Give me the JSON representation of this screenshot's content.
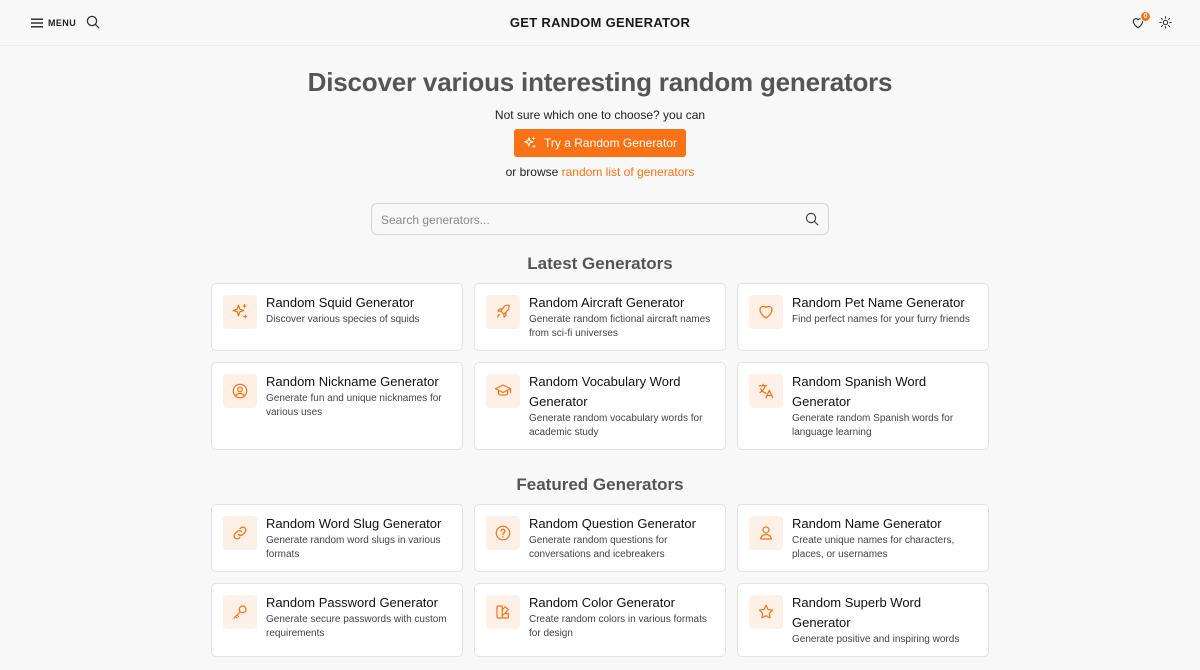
{
  "header": {
    "menu_label": "MENU",
    "brand": "GET RANDOM GENERATOR",
    "favorites_count": "0"
  },
  "hero": {
    "title": "Discover various interesting random generators",
    "subtitle": "Not sure which one to choose? you can",
    "try_button": "Try a Random Generator",
    "browse_prefix": "or browse",
    "browse_link": "random list of generators"
  },
  "search": {
    "placeholder": "Search generators..."
  },
  "latest": {
    "title": "Latest Generators",
    "items": [
      {
        "title": "Random Squid Generator",
        "desc": "Discover various species of squids",
        "icon": "sparkles-icon"
      },
      {
        "title": "Random Aircraft Generator",
        "desc": "Generate random fictional aircraft names from sci-fi universes",
        "icon": "rocket-icon"
      },
      {
        "title": "Random Pet Name Generator",
        "desc": "Find perfect names for your furry friends",
        "icon": "heart-icon"
      },
      {
        "title": "Random Nickname Generator",
        "desc": "Generate fun and unique nicknames for various uses",
        "icon": "user-circle-icon"
      },
      {
        "title": "Random Vocabulary Word Generator",
        "desc": "Generate random vocabulary words for academic study",
        "icon": "graduation-cap-icon"
      },
      {
        "title": "Random Spanish Word Generator",
        "desc": "Generate random Spanish words for language learning",
        "icon": "translate-icon"
      }
    ]
  },
  "featured": {
    "title": "Featured Generators",
    "items": [
      {
        "title": "Random Word Slug Generator",
        "desc": "Generate random word slugs in various formats",
        "icon": "link-icon"
      },
      {
        "title": "Random Question Generator",
        "desc": "Generate random questions for conversations and icebreakers",
        "icon": "question-circle-icon"
      },
      {
        "title": "Random Name Generator",
        "desc": "Create unique names for characters, places, or usernames",
        "icon": "user-icon"
      },
      {
        "title": "Random Password Generator",
        "desc": "Generate secure passwords with custom requirements",
        "icon": "key-icon"
      },
      {
        "title": "Random Color Generator",
        "desc": "Create random colors in various formats for design",
        "icon": "palette-icon"
      },
      {
        "title": "Random Superb Word Generator",
        "desc": "Generate positive and inspiring words",
        "icon": "star-icon"
      }
    ]
  },
  "colors": {
    "accent": "#f97316",
    "icon_bg": "#fdf0e6"
  }
}
